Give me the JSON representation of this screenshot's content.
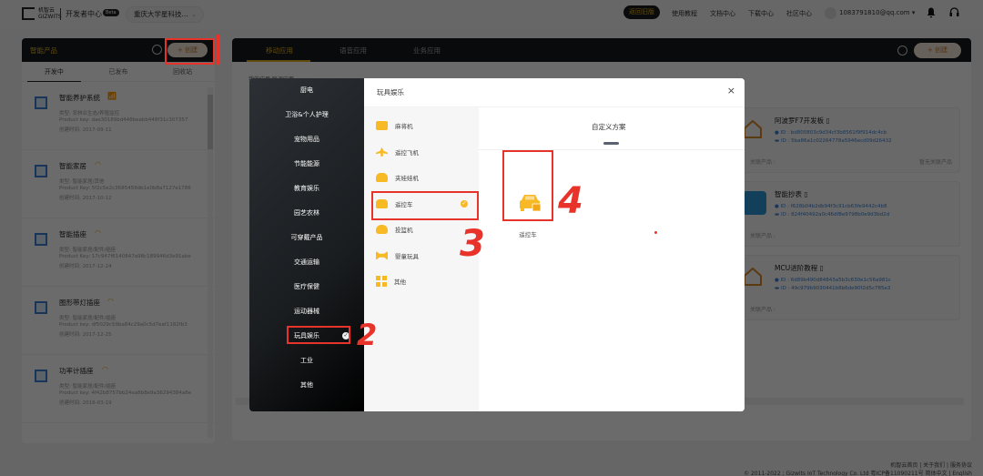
{
  "topbar": {
    "logo_cn": "机智云",
    "logo_en": "GIZWITS",
    "dev_center": "开发者中心",
    "beta_badge": "Beta",
    "org_select": "重庆大学星科技...",
    "old_version_button": "返回旧版",
    "nav_links": [
      "使用教程",
      "文档中心",
      "下载中心",
      "社区中心"
    ],
    "user_email": "1083791810@qq.com ▾"
  },
  "left_panel": {
    "title": "智能产品",
    "create_button": "+ 创建",
    "tabs": [
      "开发中",
      "已发布",
      "回收站"
    ],
    "active_tab": "开发中",
    "products": [
      {
        "name": "智能养护系统",
        "type": "类型: 农林业生态/养殖监控",
        "key": "Product key: dae30189bd448beabb448f31c307357",
        "created": "创建时间: 2017-09-11"
      },
      {
        "name": "智能家居",
        "type": "类型: 智能家居/其他",
        "key": "Product Key: 5f2c5e2c3685459db1e0b8a7127e1786",
        "created": "创建时间: 2017-10-12"
      },
      {
        "name": "智能插座",
        "type": "类型: 智能家居/配件/插座",
        "key": "Product Key: 17c947f6140847a98c189946d3e91abe",
        "created": "创建时间: 2017-12-24"
      },
      {
        "name": "图形带灯插座",
        "type": "类型: 智能家居/配件/插座",
        "key": "Product key: df5029c59ba84c29a0c5d7eaf1182fb3",
        "created": "创建时间: 2017-12-25"
      },
      {
        "name": "功率计插座",
        "type": "类型: 智能家居/配件/插座",
        "key": "Product key: 4f42b8757bb24ea8b8e9a36294384a6e",
        "created": "创建时间: 2018-03-19"
      }
    ]
  },
  "right_panel": {
    "tabs": [
      "移动应用",
      "语音应用",
      "业务应用"
    ],
    "active_tab": "移动应用",
    "create_button": "+ 创建",
    "subtabs": "我的应用      联调应用",
    "apps": [
      {
        "name": "阿波罗F7开发板 ▯",
        "ios_id": "● ID : bd800803c9d34cf3b8561f9f914dc4cb",
        "android_id": "▬ ID : 5ba86a1c02264778a5946ecd09d26432",
        "assoc_label": "关联产品 :",
        "assoc_value": "暂无关联产品"
      },
      {
        "name": "智能抄表 ▯",
        "ios_id": "● ID : f628b04b2db94f3c91cb63fe9442c4b8",
        "android_id": "▬ ID : 824f40492a0c46df8e9798b0e9d3bd2d",
        "assoc_label": "关联产品 :",
        "assoc_value": ""
      },
      {
        "name": "MCU进阶教程 ▯",
        "ios_id": "● ID : 6d89b490d84843a5b3c630e1c56a981c",
        "android_id": "▬ ID : 49c979b9030441b8b6de90f2d5c785e3",
        "assoc_label": "关联产品 :",
        "assoc_value": ""
      }
    ]
  },
  "modal": {
    "categories": [
      "厨电",
      "卫浴&个人护理",
      "宠物用品",
      "节能能源",
      "教育娱乐",
      "园艺农林",
      "可穿戴产品",
      "交通运输",
      "医疗保健",
      "运动器械",
      "玩具娱乐",
      "工业",
      "其他"
    ],
    "selected_category": "玩具娱乐",
    "subcategory_header": "玩具娱乐",
    "subcategories": [
      "麻将机",
      "遥控飞机",
      "夹娃娃机",
      "遥控车",
      "投篮机",
      "婴童玩具",
      "其他"
    ],
    "selected_subcategory": "遥控车",
    "scheme_tab": "自定义方案",
    "scheme_card_label": "遥控车",
    "close": "×"
  },
  "annotations": [
    "1",
    "2",
    "3",
    "4"
  ],
  "footer": {
    "links": "机智云首页 | 关于我们 | 服务协议",
    "copyright": "© 2011-2022 ; Gizwits IoT Technology Co. Ltd 粤ICP备11090211号 简体中文 | English"
  },
  "colors": {
    "accent": "#e3b21f",
    "icon_yellow": "#f7b924",
    "annotation_red": "#e8332b",
    "dark_header": "#15181b"
  }
}
